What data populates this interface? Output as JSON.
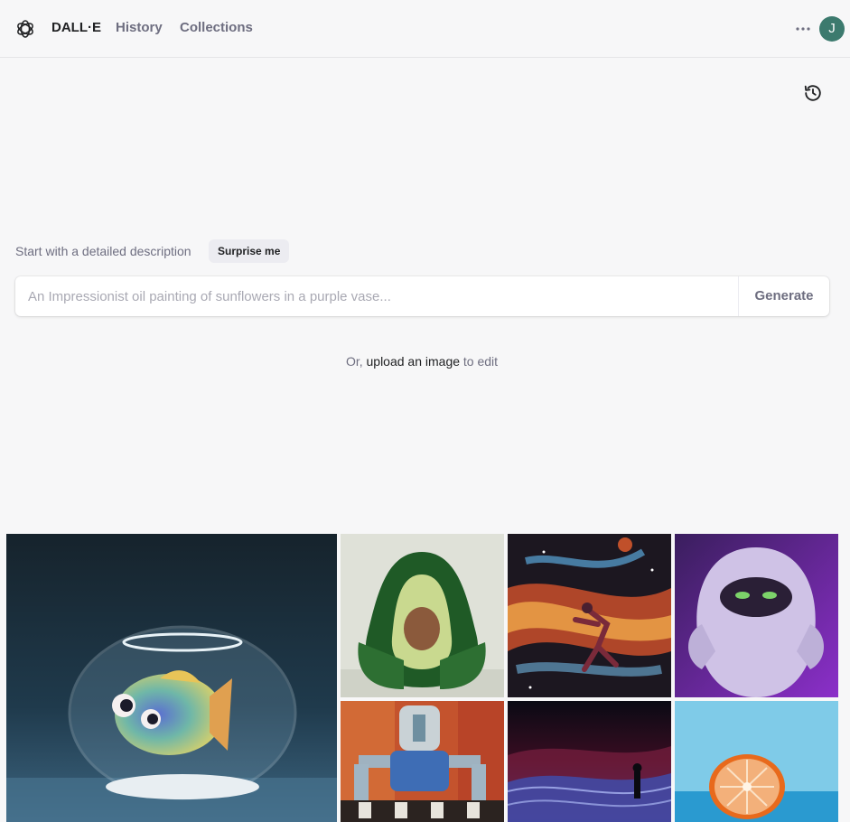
{
  "nav": {
    "brand": "DALL·E",
    "history": "History",
    "collections": "Collections",
    "avatar_initial": "J",
    "more_icon": "more-horizontal-icon",
    "avatar_color": "#3c7a6e"
  },
  "prompt": {
    "label": "Start with a detailed description",
    "surprise_label": "Surprise me",
    "placeholder": "An Impressionist oil painting of sunflowers in a purple vase...",
    "value": "",
    "generate_label": "Generate"
  },
  "upload": {
    "prefix": "Or,",
    "link": "upload an image",
    "suffix": "to edit"
  },
  "gallery": {
    "items": [
      {
        "subject": "fish-in-bowl"
      },
      {
        "subject": "avocado-chair"
      },
      {
        "subject": "space-basketball"
      },
      {
        "subject": "purple-monster"
      },
      {
        "subject": "robot-painting"
      },
      {
        "subject": "night-dunes"
      },
      {
        "subject": "orange-half"
      }
    ]
  }
}
